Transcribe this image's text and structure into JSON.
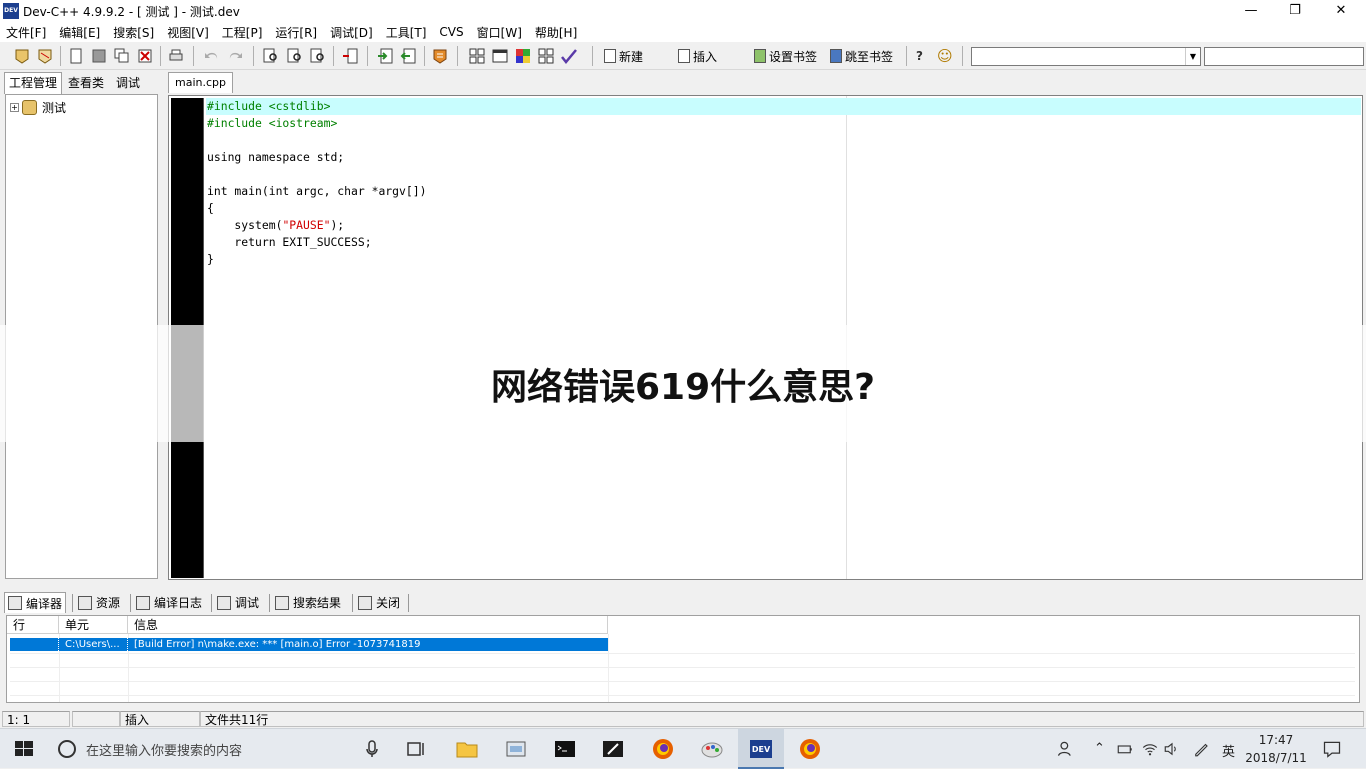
{
  "window": {
    "app_icon_text": "DEV",
    "title": "Dev-C++ 4.9.9.2  -  [ 测试 ] - 测试.dev",
    "minimize": "—",
    "restore": "❐",
    "close": "✕"
  },
  "menu": [
    "文件[F]",
    "编辑[E]",
    "搜索[S]",
    "视图[V]",
    "工程[P]",
    "运行[R]",
    "调试[D]",
    "工具[T]",
    "CVS",
    "窗口[W]",
    "帮助[H]"
  ],
  "toolbar": {
    "new_label": "新建",
    "insert_label": "插入",
    "set_bookmark_label": "设置书签",
    "goto_bookmark_label": "跳至书签",
    "help_icon": "?",
    "about_icon": "☺",
    "combo1_value": "",
    "combo2_value": ""
  },
  "left_panel": {
    "tabs": [
      "工程管理",
      "查看类",
      "调试"
    ],
    "tree": {
      "expander": "+",
      "project": "测试"
    }
  },
  "editor": {
    "tab": "main.cpp",
    "lines": [
      "#include <cstdlib>",
      "#include <iostream>",
      "",
      "using namespace std;",
      "",
      "int main(int argc, char *argv[])",
      "{",
      "    system(\"PAUSE\");",
      "    return EXIT_SUCCESS;",
      "}"
    ]
  },
  "overlay": {
    "headline": "网络错误619什么意思?"
  },
  "bottom_panel": {
    "tabs": [
      "编译器",
      "资源",
      "编译日志",
      "调试",
      "搜索结果",
      "关闭"
    ],
    "columns": [
      "行",
      "单元",
      "信息"
    ],
    "rows": [
      {
        "line": "",
        "unit": "C:\\Users\\...",
        "message": "[Build Error]  n\\make.exe: *** [main.o] Error -1073741819"
      }
    ]
  },
  "statusbar": {
    "position": "1: 1",
    "modified": "",
    "mode": "插入",
    "line_count": "文件共11行"
  },
  "taskbar": {
    "search_placeholder": "在这里输入你要搜索的内容",
    "ime": "英",
    "time": "17:47",
    "date": "2018/7/11"
  },
  "colors": {
    "current_line": "#c8fdfe",
    "preprocessor": "#008000",
    "string": "#d00000",
    "selection": "#0078d7",
    "app_icon": "#1c3f8f"
  }
}
